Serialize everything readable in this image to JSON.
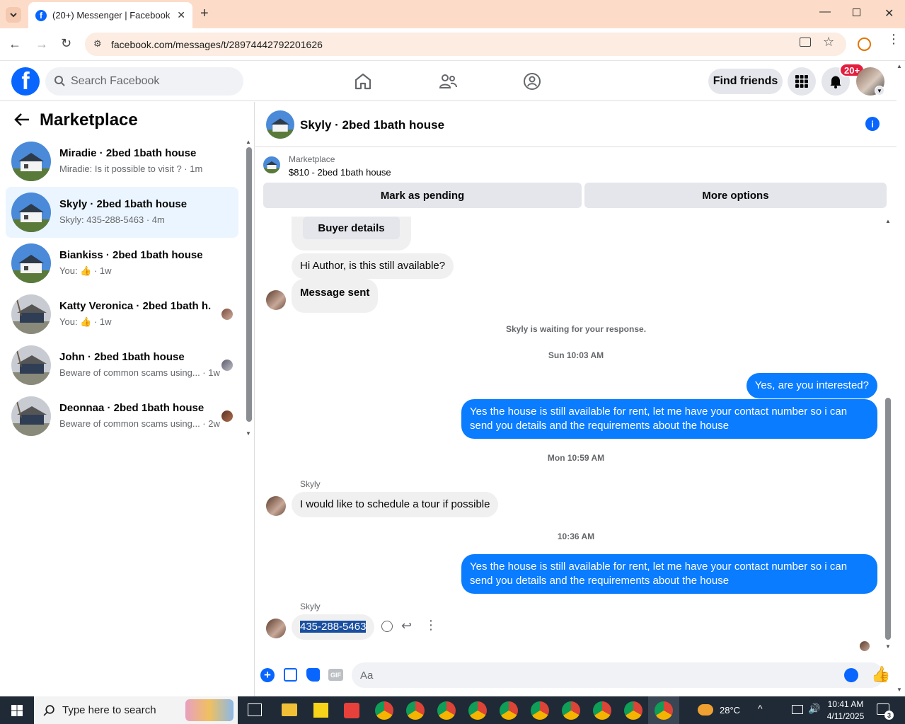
{
  "browser": {
    "tab_title": "(20+) Messenger | Facebook",
    "url": "facebook.com/messages/t/28974442792201626"
  },
  "header": {
    "search_placeholder": "Search Facebook",
    "find_friends": "Find friends",
    "notif_count": "20+"
  },
  "sidebar": {
    "title": "Marketplace",
    "conversations": [
      {
        "name": "Miradie · 2bed 1bath house",
        "preview": "Miradie: Is it possible to visit ? · 1m",
        "active": false
      },
      {
        "name": "Skyly · 2bed 1bath house",
        "preview": "Skyly: 435-288-5463 · 4m",
        "active": true
      },
      {
        "name": "Biankiss · 2bed 1bath house",
        "preview_prefix": "You:",
        "preview_suffix": " · 1w",
        "active": false
      },
      {
        "name": "Katty Veronica · 2bed 1bath h...",
        "preview_prefix": "You:",
        "preview_suffix": " · 1w",
        "active": false
      },
      {
        "name": "John · 2bed 1bath house",
        "preview": "Beware of common scams using... · 1w",
        "active": false
      },
      {
        "name": "Deonnaa · 2bed 1bath house",
        "preview": "Beware of common scams using... · 2w",
        "active": false
      }
    ]
  },
  "chat": {
    "title": "Skyly · 2bed 1bath house",
    "marketplace_label": "Marketplace",
    "listing": "$810 - 2bed 1bath house",
    "mark_pending": "Mark as pending",
    "more_options": "More options",
    "buyer_details": "Buyer details",
    "msg_hi": "Hi Author, is this still available?",
    "msg_sent": "Message sent",
    "waiting": "Skyly is waiting for your response.",
    "stamp1": "Sun 10:03 AM",
    "out1": "Yes, are you interested?",
    "out2": "Yes the house is still available for rent, let me have your contact number so i can send you details and the requirements about the house",
    "stamp2": "Mon 10:59 AM",
    "sender": "Skyly",
    "in_tour": "I would like to schedule a tour if possible",
    "stamp3": "10:36 AM",
    "out3": "Yes the house is still available for rent, let me have your contact number so i can send you details and the requirements about the house",
    "in_phone": "435-288-5463",
    "composer_placeholder": "Aa"
  },
  "taskbar": {
    "search": "Type here to search",
    "temp": "28°C",
    "time": "10:41 AM",
    "date": "4/11/2025",
    "notif": "3"
  },
  "colors": {
    "brand": "#0866ff",
    "outgoing": "#0a7cff",
    "active_row": "#ebf5ff"
  }
}
